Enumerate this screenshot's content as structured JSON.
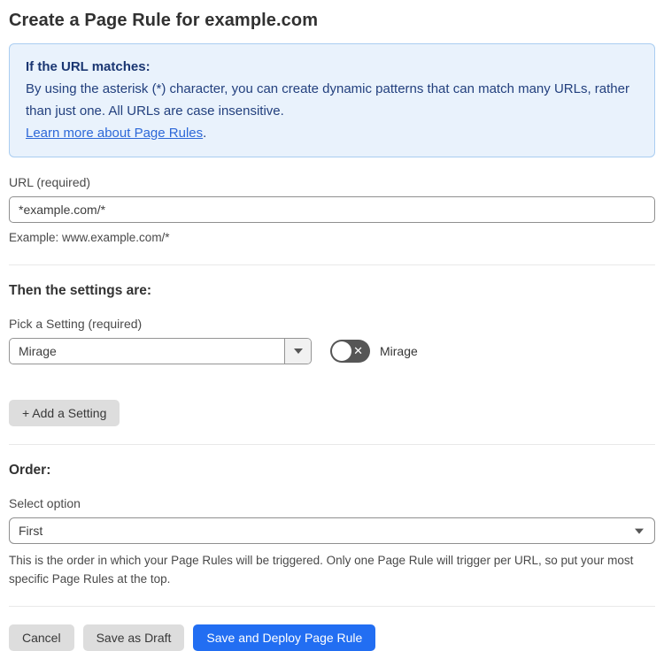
{
  "page": {
    "title": "Create a Page Rule for example.com"
  },
  "info_box": {
    "heading": "If the URL matches:",
    "body": "By using the asterisk (*) character, you can create dynamic patterns that can match many URLs, rather than just one. All URLs are case insensitive.",
    "link_label": "Learn more about Page Rules",
    "link_suffix": "."
  },
  "url_field": {
    "label": "URL (required)",
    "value": "*example.com/*",
    "example": "Example: www.example.com/*"
  },
  "settings_section": {
    "heading": "Then the settings are:",
    "picker_label": "Pick a Setting (required)",
    "picker_value": "Mirage",
    "toggle_state": "off",
    "toggle_icon": "✕",
    "toggle_label": "Mirage",
    "add_button_label": "+ Add a Setting"
  },
  "order_section": {
    "heading": "Order:",
    "select_label": "Select option",
    "select_value": "First",
    "help_text": "This is the order in which your Page Rules will be triggered. Only one Page Rule will trigger per URL, so put your most specific Page Rules at the top."
  },
  "footer": {
    "cancel_label": "Cancel",
    "save_draft_label": "Save as Draft",
    "deploy_label": "Save and Deploy Page Rule"
  },
  "colors": {
    "accent_blue": "#226ef2",
    "info_background": "#e9f2fc",
    "info_border": "#aacdf1",
    "info_text": "#23407e",
    "link_blue": "#2d68d8",
    "toggle_off_gray": "#565656",
    "button_gray": "#dddddd"
  }
}
